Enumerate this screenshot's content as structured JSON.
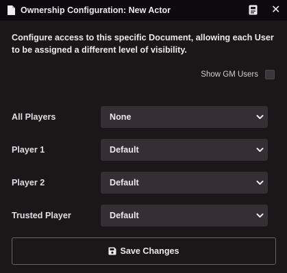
{
  "window": {
    "title": "Ownership Configuration: New Actor",
    "title_icon": "file-icon",
    "sheet_icon": "sheet-icon",
    "close_glyph": "✕"
  },
  "intro": {
    "text": "Configure access to this specific Document, allowing each User to be assigned a different level of visibility."
  },
  "gm_toggle": {
    "label": "Show GM Users",
    "checked": false
  },
  "permissions": [
    {
      "label": "All Players",
      "value": "None"
    },
    {
      "label": "Player 1",
      "value": "Default"
    },
    {
      "label": "Player 2",
      "value": "Default"
    },
    {
      "label": "Trusted Player",
      "value": "Default"
    }
  ],
  "save": {
    "label": "Save Changes",
    "icon": "save-icon"
  },
  "colors": {
    "background": "#1b1719",
    "titlebar": "#0c0a0c",
    "select_bg": "#352e33",
    "text": "#ece8ec"
  }
}
